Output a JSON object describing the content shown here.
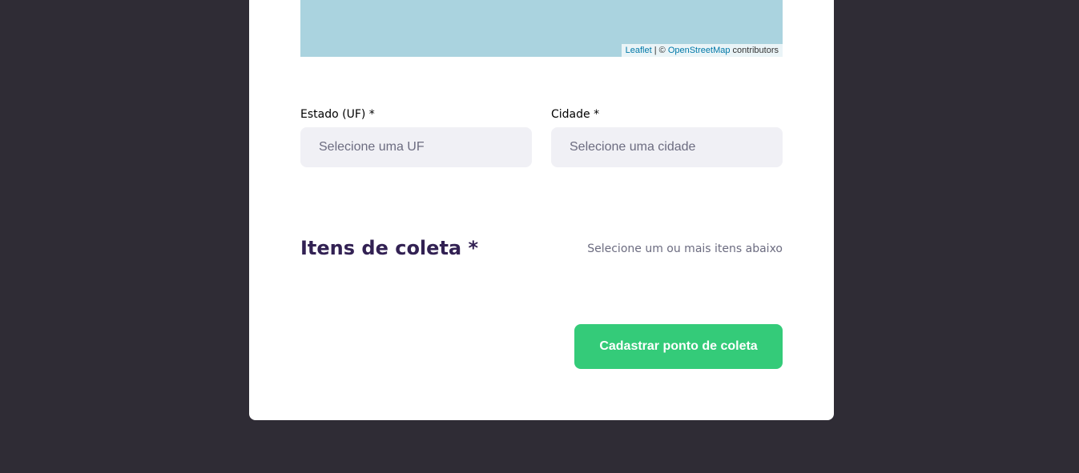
{
  "map": {
    "attribution_leaflet": "Leaflet",
    "attribution_separator": " | © ",
    "attribution_osm": "OpenStreetMap",
    "attribution_suffix": " contributors",
    "background_color": "#aad3df"
  },
  "form": {
    "uf_label": "Estado (UF) *",
    "uf_placeholder": "Selecione uma UF",
    "city_label": "Cidade *",
    "city_placeholder": "Selecione uma cidade"
  },
  "items_section": {
    "title": "Itens de coleta *",
    "hint": "Selecione um ou mais itens abaixo"
  },
  "submit": {
    "label": "Cadastrar ponto de coleta",
    "color": "#34cb79"
  },
  "colors": {
    "page_background": "#2f2c35",
    "card_background": "#ffffff",
    "title_color": "#322153",
    "muted_text": "#6c6c80",
    "input_background": "#f0f0f5"
  }
}
